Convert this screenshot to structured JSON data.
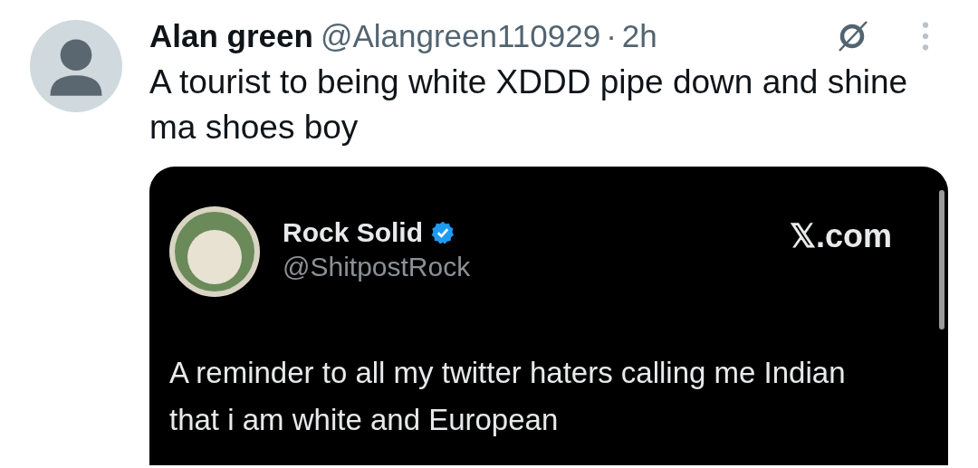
{
  "post": {
    "name": "Alan green",
    "handle": "@Alangreen110929",
    "separator": "·",
    "time": "2h",
    "text": "A tourist to being white XDDD pipe down and shine ma shoes boy"
  },
  "quote": {
    "name": "Rock Solid",
    "verified": true,
    "handle": "@ShitpostRock",
    "source": "𝕏.com",
    "text": "A reminder to all my twitter haters calling me Indian that i am white and European"
  }
}
